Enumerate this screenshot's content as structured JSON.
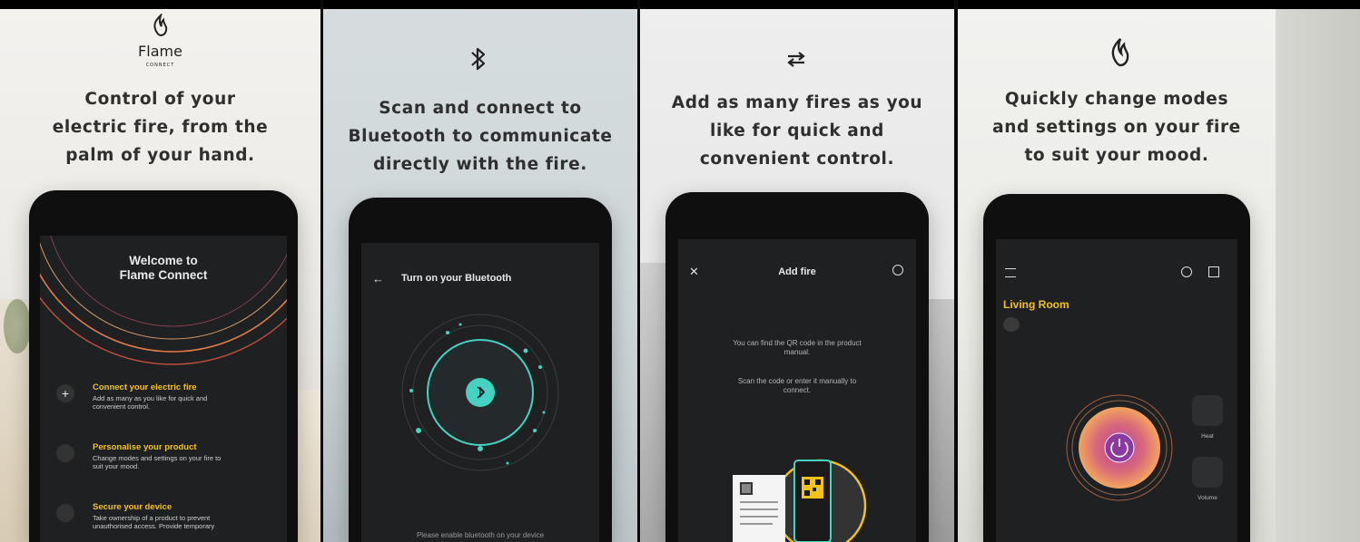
{
  "panels": [
    {
      "headline": [
        "Control of your",
        "electric fire, from the",
        "palm of your hand."
      ],
      "brand": {
        "name": "Flame",
        "sub": "CONNECT"
      },
      "screen": {
        "title": [
          "Welcome to",
          "Flame Connect"
        ],
        "items": [
          {
            "title": "Connect your electric fire",
            "desc": [
              "Add as many as you like for quick and",
              "convenient control."
            ]
          },
          {
            "title": "Personalise your product",
            "desc": [
              "Change modes and settings on your fire to",
              "suit your mood."
            ]
          },
          {
            "title": "Secure your device",
            "desc": [
              "Take ownership of a product to prevent",
              "unauthorised access. Provide temporary"
            ]
          }
        ]
      }
    },
    {
      "headline": [
        "Scan and connect to",
        "Bluetooth to communicate",
        "directly with the fire."
      ],
      "screen": {
        "title": "Turn on your Bluetooth",
        "footer": "Please enable bluetooth on your device"
      }
    },
    {
      "headline": [
        "Add as many fires as you",
        "like for quick and",
        "convenient control."
      ],
      "screen": {
        "title": "Add fire",
        "line1": [
          "You can find the QR code in the product",
          "manual."
        ],
        "line2": [
          "Scan the code or enter it manually to",
          "connect."
        ]
      }
    },
    {
      "headline": [
        "Quickly change modes",
        "and settings on your fire",
        "to suit your mood."
      ],
      "screen": {
        "room": "Living Room",
        "heat_label": "Heat",
        "volume_label": "Volume"
      }
    }
  ],
  "colors": {
    "accent_yellow": "#f2c21b",
    "bt_teal": "#43d3c0",
    "ring_orange": "#e07a4a",
    "power_gradient_start": "#b63d9f",
    "power_gradient_end": "#f3a55d"
  },
  "icons": [
    "flame-icon",
    "bluetooth-icon",
    "swap-arrows-icon",
    "flame-outline-icon",
    "plus-icon",
    "lock-icon",
    "back-arrow-icon",
    "close-icon",
    "help-icon",
    "menu-icon",
    "grid-icon",
    "power-icon",
    "heat-icon",
    "volume-icon",
    "qr-code-icon"
  ]
}
